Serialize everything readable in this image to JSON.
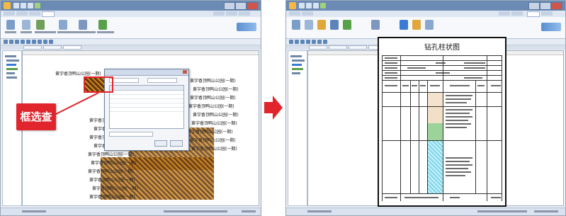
{
  "annotation": {
    "callout_label": "框选查询",
    "accent_color": "#e0252d",
    "arrow_icon": "red-right-arrow-icon"
  },
  "left_window": {
    "map_label_text": "黄宇香顶鸭山公园(一期)"
  },
  "right_window": {
    "report_title": "钻孔柱状图"
  }
}
